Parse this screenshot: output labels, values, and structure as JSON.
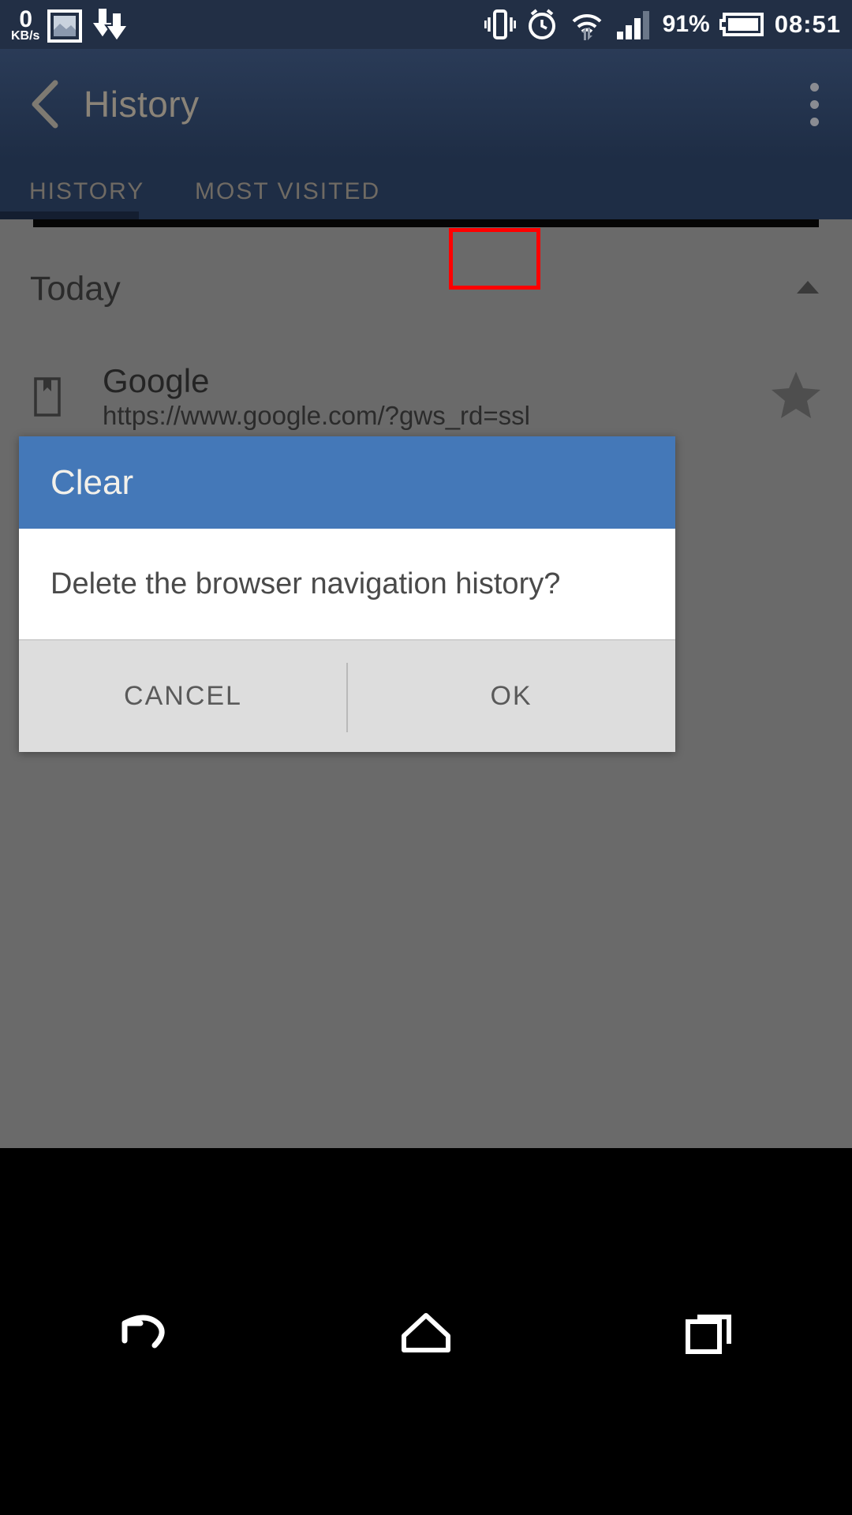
{
  "status_bar": {
    "network_speed_value": "0",
    "network_speed_unit": "KB/s",
    "battery_percent": "91%",
    "clock": "08:51",
    "icons": [
      "image-icon",
      "download-icon",
      "vibrate-icon",
      "alarm-icon",
      "wifi-icon",
      "signal-icon",
      "battery-icon"
    ]
  },
  "app_bar": {
    "title": "History",
    "back_icon": "back-chevron-icon",
    "overflow_icon": "overflow-menu-icon"
  },
  "tabs": [
    {
      "label": "HISTORY",
      "active": true
    },
    {
      "label": "MOST VISITED",
      "active": false
    }
  ],
  "content": {
    "section": {
      "title": "Today",
      "collapse_icon": "triangle-up-icon"
    },
    "history_items": [
      {
        "icon": "page-bookmark-icon",
        "title": "Google",
        "url": "https://www.google.com/?gws_rd=ssl",
        "star_icon": "star-icon"
      }
    ]
  },
  "dialog": {
    "title": "Clear",
    "message": "Delete the browser navigation history?",
    "cancel_label": "CANCEL",
    "ok_label": "OK",
    "header_color": "#4478b8",
    "highlight_color": "#ff0000"
  },
  "nav_bar": {
    "back_label": "back-icon",
    "home_label": "home-icon",
    "recents_label": "recents-icon"
  }
}
